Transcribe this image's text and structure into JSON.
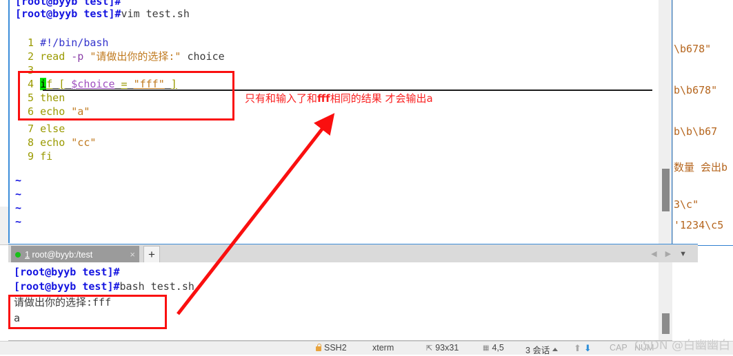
{
  "background_window": {
    "lines": [
      "\\b678\"",
      "b\\b678\"",
      "b\\b\\b67",
      "数量 会出b",
      "3\\c\"",
      "'1234\\c5"
    ]
  },
  "vim_pane": {
    "top_prompt_cut": "[root@byyb test]#",
    "prompt": "[root@byyb test]#",
    "command": "vim test.sh",
    "code_lines": [
      {
        "num": "1",
        "text": "#!/bin/bash"
      },
      {
        "num": "2",
        "text": "read -p \"请做出你的选择:\" choice"
      },
      {
        "num": "3",
        "text": ""
      },
      {
        "num": "4",
        "text": "if [ $choice = \"fff\" ]"
      },
      {
        "num": "5",
        "text": "then"
      },
      {
        "num": "6",
        "text": "echo \"a\""
      },
      {
        "num": "7",
        "text": "else"
      },
      {
        "num": "8",
        "text": "echo \"cc\""
      },
      {
        "num": "9",
        "text": "fi"
      }
    ],
    "empty_markers": [
      "~",
      "~",
      "~",
      "~"
    ],
    "cursor_char": "i"
  },
  "annotation": {
    "note_before": "只有和输入了和",
    "note_bold": "fff",
    "note_after": "相同的结果 才会输出a",
    "color": "#fa2020"
  },
  "tabbar": {
    "tab_index": "1",
    "tab_title": "root@byyb:/test",
    "close_label": "×",
    "add_label": "+",
    "nav_prev": "◀",
    "nav_next": "▶",
    "nav_menu": "▼"
  },
  "terminal": {
    "lines": [
      {
        "prompt": "[root@byyb test]#",
        "cmd": ""
      },
      {
        "prompt": "[root@byyb test]#",
        "cmd": "bash test.sh"
      },
      {
        "prompt": "",
        "cmd": "请做出你的选择:fff"
      },
      {
        "prompt": "",
        "cmd": "a"
      }
    ]
  },
  "statusbar": {
    "protocol": "SSH2",
    "term_type": "xterm",
    "size": "93x31",
    "cursor_pos": "4,5",
    "sessions": "3 会话",
    "cap": "CAP",
    "num": "NUM"
  },
  "watermark": "CSDN @白幽幽白"
}
